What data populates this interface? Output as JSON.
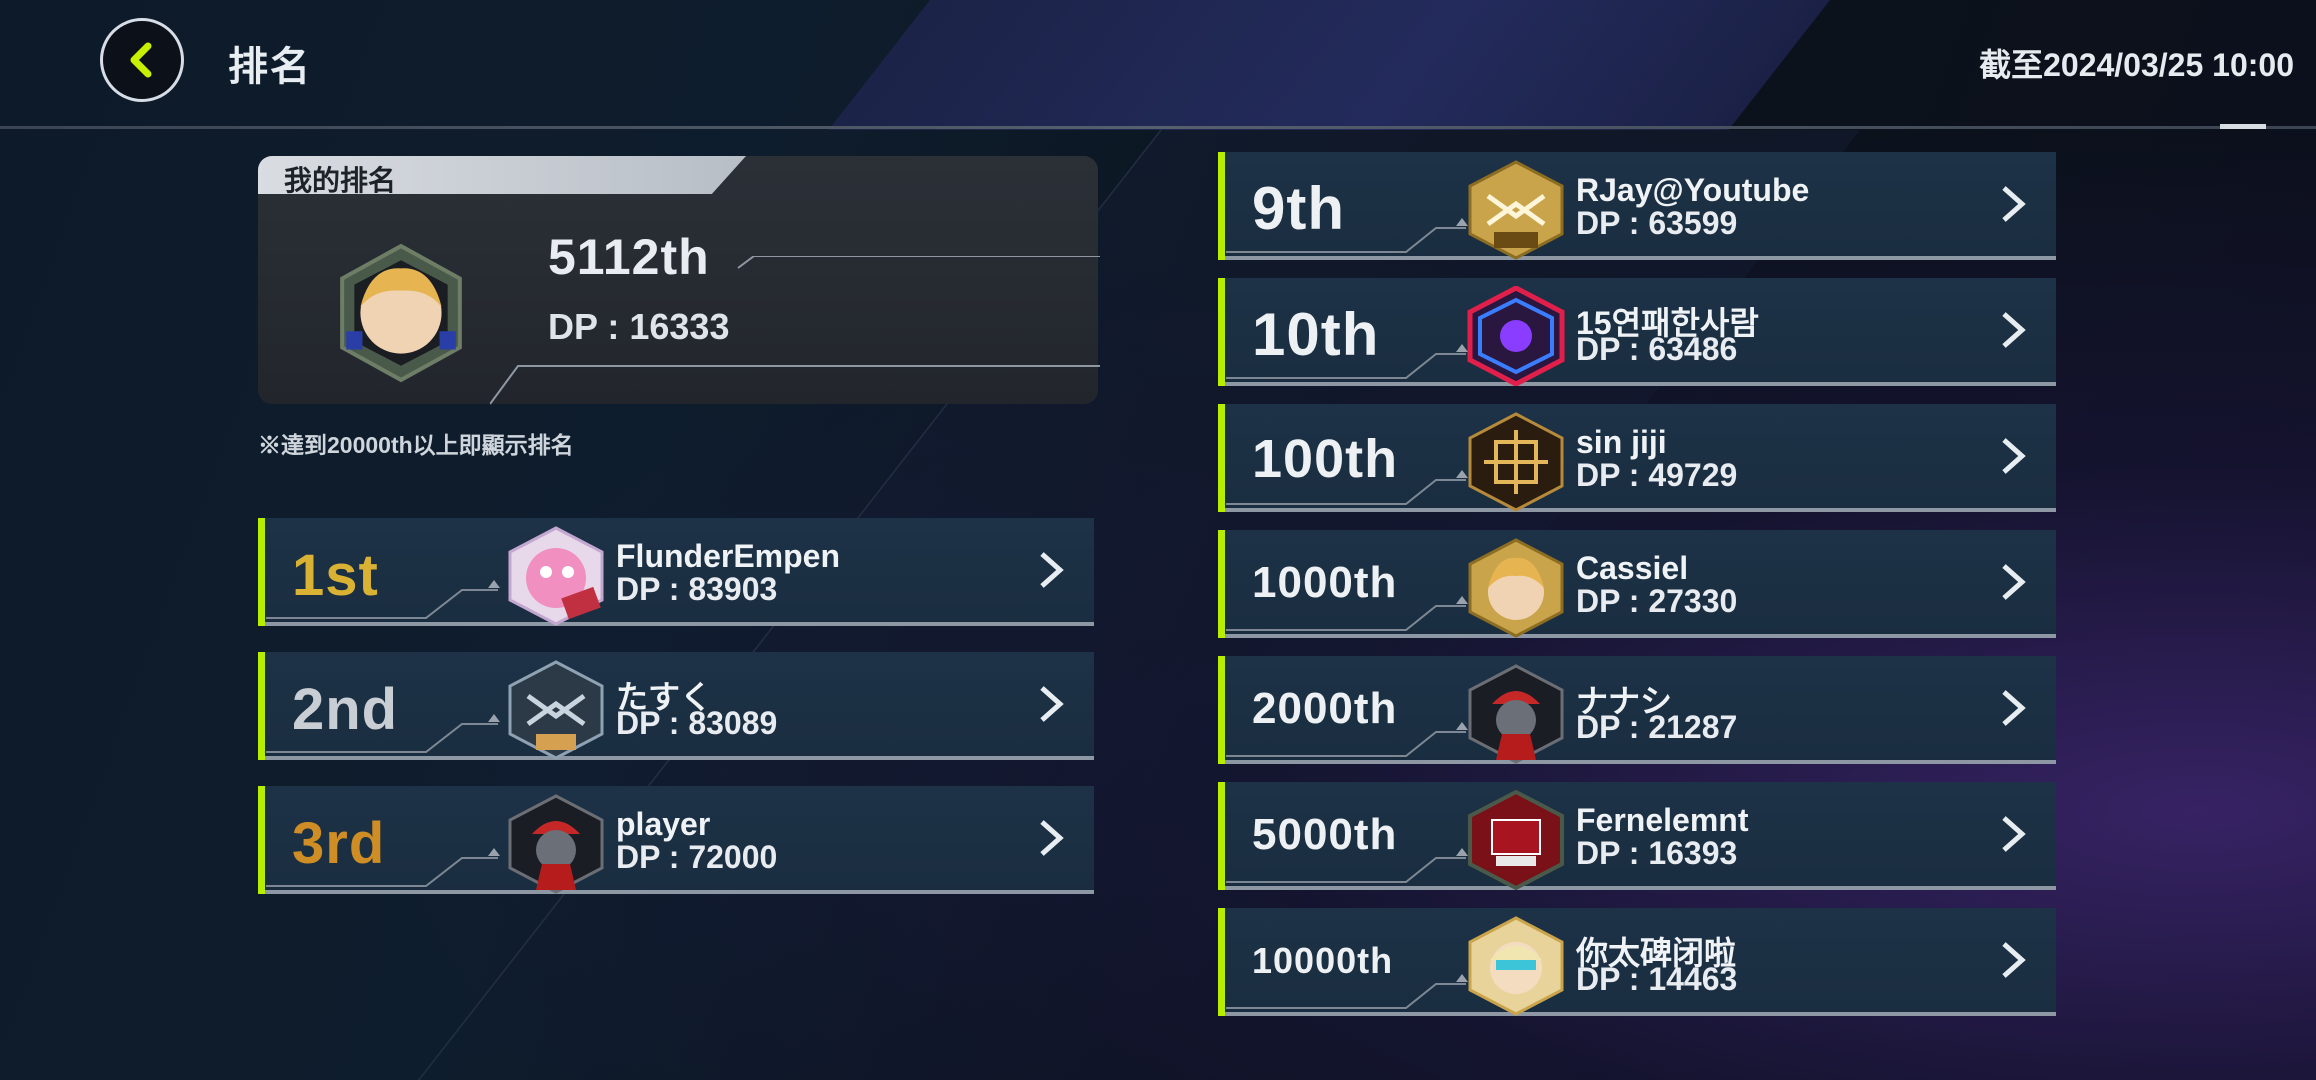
{
  "header": {
    "title": "排名",
    "deadline": "截至2024/03/25  10:00"
  },
  "my_ranking": {
    "tab_label": "我的排名",
    "rank": "5112th",
    "dp": "DP : 16333",
    "note": "※達到20000th以上即顯示排名"
  },
  "left_rows": [
    {
      "rank": "1st",
      "name": "FlunderEmpen",
      "dp": "DP : 83903"
    },
    {
      "rank": "2nd",
      "name": "たすく",
      "dp": "DP : 83089"
    },
    {
      "rank": "3rd",
      "name": "player",
      "dp": "DP : 72000"
    }
  ],
  "right_rows": [
    {
      "rank": "9th",
      "name": "RJay@Youtube",
      "dp": "DP : 63599"
    },
    {
      "rank": "10th",
      "name": "15연패한사람",
      "dp": "DP : 63486"
    },
    {
      "rank": "100th",
      "name": "sin  jiji",
      "dp": "DP : 49729"
    },
    {
      "rank": "1000th",
      "name": "Cassiel",
      "dp": "DP : 27330"
    },
    {
      "rank": "2000th",
      "name": "ナナシ",
      "dp": "DP : 21287"
    },
    {
      "rank": "5000th",
      "name": "Fernelemnt",
      "dp": "DP : 16393"
    },
    {
      "rank": "10000th",
      "name": "你太碑闭啦",
      "dp": "DP : 14463"
    }
  ],
  "icons": {
    "back": "back-arrow-icon",
    "row_chevron": "chevron-right-icon"
  },
  "colors": {
    "accent": "#b7ee00",
    "gold": "#d9b233",
    "silver": "#c9ced4",
    "bronze": "#cf8d25",
    "row_bg": "#1b2f43"
  }
}
